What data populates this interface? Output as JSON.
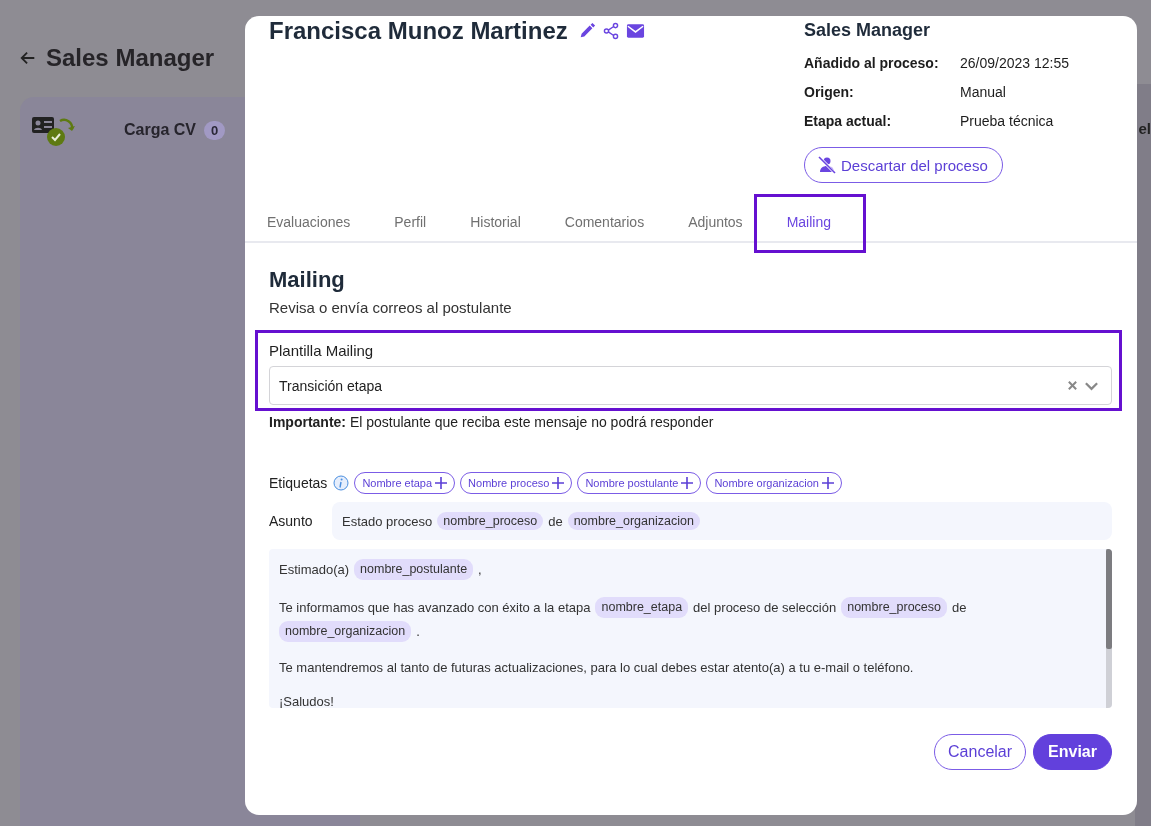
{
  "background": {
    "back_title": "Sales Manager",
    "columns": [
      {
        "title": "Carga CV",
        "count": "0"
      }
    ],
    "edge_texts": [
      "el"
    ]
  },
  "modal": {
    "candidate_name": "Francisca Munoz Martinez",
    "process_title": "Sales Manager",
    "details": [
      {
        "label": "Añadido al proceso:",
        "value": "26/09/2023 12:55"
      },
      {
        "label": "Origen:",
        "value": "Manual"
      },
      {
        "label": "Etapa actual:",
        "value": "Prueba técnica"
      }
    ],
    "discard_button": "Descartar del proceso",
    "tabs": [
      {
        "label": "Evaluaciones",
        "selected": false,
        "highlighted": false
      },
      {
        "label": "Perfil",
        "selected": false,
        "highlighted": false
      },
      {
        "label": "Historial",
        "selected": false,
        "highlighted": false
      },
      {
        "label": "Comentarios",
        "selected": false,
        "highlighted": false
      },
      {
        "label": "Adjuntos",
        "selected": false,
        "highlighted": false
      },
      {
        "label": "Mailing",
        "selected": true,
        "highlighted": true
      }
    ],
    "section_title": "Mailing",
    "section_subtitle": "Revisa o envía correos al postulante",
    "template": {
      "label": "Plantilla Mailing",
      "value": "Transición etapa",
      "highlighted": true
    },
    "notice": "**Importante:** El postulante que reciba este mensaje no podrá responder",
    "tags_label": "Etiquetas",
    "tag_buttons": [
      "Nombre etapa",
      "Nombre proceso",
      "Nombre postulante",
      "Nombre organizacion"
    ],
    "subject_label": "Asunto",
    "subject": [
      {
        "kind": "text",
        "text": "Estado proceso"
      },
      {
        "kind": "tag",
        "text": "nombre_proceso"
      },
      {
        "kind": "text",
        "text": "de"
      },
      {
        "kind": "tag",
        "text": "nombre_organizacion"
      }
    ],
    "body": [
      {
        "parts": [
          {
            "kind": "text",
            "text": "Estimado(a)"
          },
          {
            "kind": "tag",
            "text": "nombre_postulante"
          },
          {
            "kind": "text",
            "text": ","
          }
        ]
      },
      {
        "parts": [
          {
            "kind": "text",
            "text": "Te informamos que has avanzado con éxito a la etapa"
          },
          {
            "kind": "tag",
            "text": "nombre_etapa"
          },
          {
            "kind": "text",
            "text": "del proceso de selección"
          },
          {
            "kind": "tag",
            "text": "nombre_proceso"
          },
          {
            "kind": "text",
            "text": "de"
          },
          {
            "kind": "tag",
            "text": "nombre_organizacion"
          },
          {
            "kind": "text",
            "text": "."
          }
        ]
      },
      {
        "parts": [
          {
            "kind": "text",
            "text": "Te mantendremos al tanto de futuras actualizaciones, para lo cual debes estar atento(a) a tu e-mail o teléfono."
          }
        ]
      },
      {
        "parts": [
          {
            "kind": "text",
            "text": "¡Saludos!"
          }
        ]
      }
    ],
    "buttons": [
      {
        "kind": "secondary",
        "label": "Cancelar"
      },
      {
        "kind": "primary",
        "label": "Enviar"
      }
    ]
  }
}
